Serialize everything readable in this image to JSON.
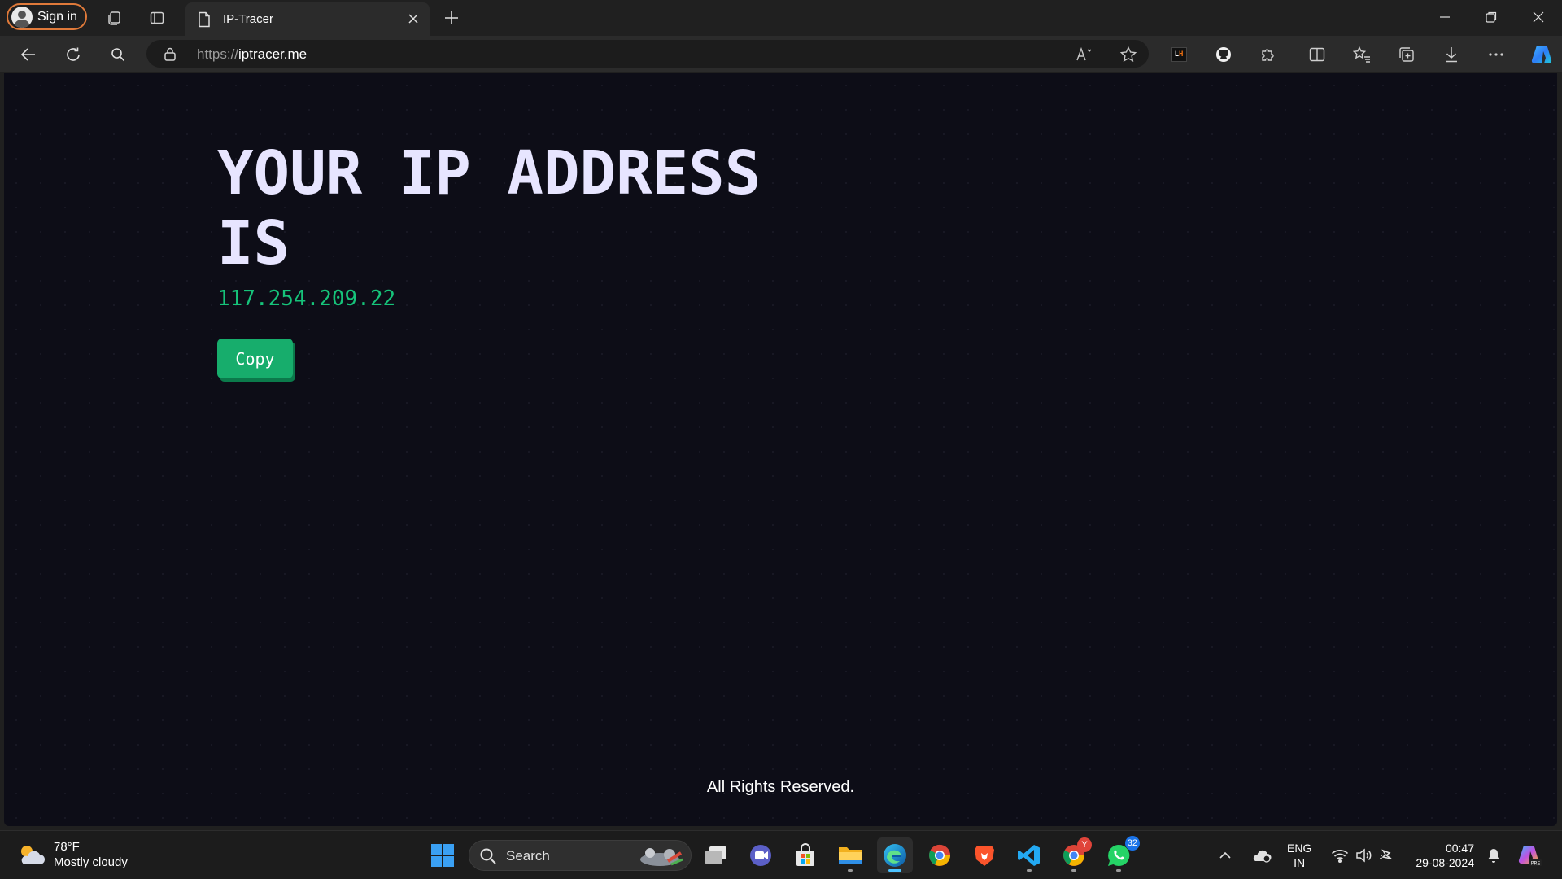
{
  "browser": {
    "signin_label": "Sign in",
    "tab_title": "IP-Tracer",
    "url_scheme": "https://",
    "url_host": "iptracer.me",
    "extension_lh_label": "LH"
  },
  "page": {
    "headline": "YOUR IP ADDRESS IS",
    "ip_address": "117.254.209.22",
    "copy_label": "Copy",
    "footer": "All Rights Reserved."
  },
  "taskbar": {
    "weather_temp": "78°F",
    "weather_desc": "Mostly cloudy",
    "search_label": "Search",
    "chrome_badge": "Y",
    "whatsapp_badge": "32",
    "lang_primary": "ENG",
    "lang_secondary": "IN",
    "time": "00:47",
    "date": "29-08-2024"
  },
  "colors": {
    "page_bg": "#0d0d17",
    "headline": "#e7e5ff",
    "ip_green": "#16c37a",
    "button_green": "#17ad6c"
  }
}
